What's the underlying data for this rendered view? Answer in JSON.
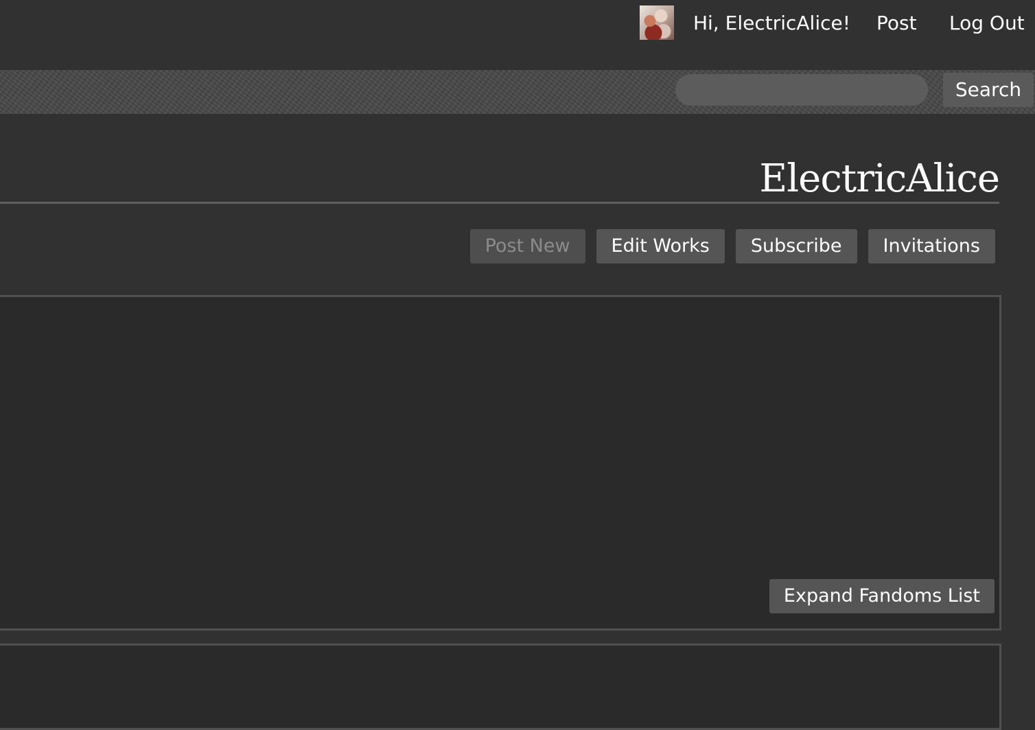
{
  "user_bar": {
    "greeting": "Hi, ElectricAlice!",
    "post": "Post",
    "log_out": "Log Out",
    "avatar_icon": "user-avatar-image"
  },
  "search": {
    "value": "",
    "placeholder": "",
    "button_label": "Search"
  },
  "profile": {
    "title": "ElectricAlice"
  },
  "actions": [
    {
      "label": "Post New",
      "disabled": true
    },
    {
      "label": "Edit Works",
      "disabled": false
    },
    {
      "label": "Subscribe",
      "disabled": false
    },
    {
      "label": "Invitations",
      "disabled": false
    }
  ],
  "fandoms": {
    "expand_label": "Expand Fandoms List"
  },
  "colors": {
    "background": "#313131",
    "panel": "#2a2a2a",
    "panel_border": "#505050",
    "button": "#555555",
    "button_disabled_text": "#8c8c8c",
    "text": "#ffffff"
  }
}
